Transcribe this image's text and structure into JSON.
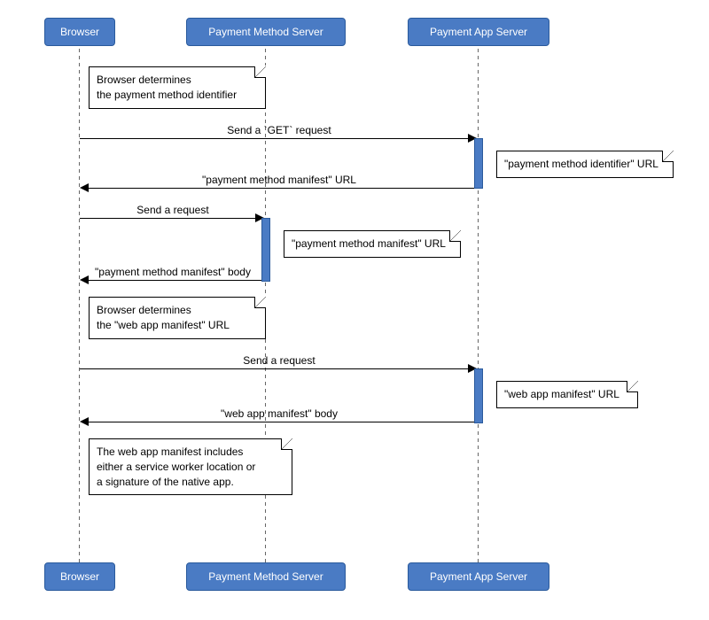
{
  "actors": {
    "browser": "Browser",
    "pms": "Payment Method Server",
    "pas": "Payment App Server"
  },
  "notes": {
    "n1": "Browser determines\nthe payment method identifier",
    "n2": "\"payment method identifier\" URL",
    "n3": "\"payment method manifest\" URL",
    "n4": "Browser determines\nthe \"web app manifest\" URL",
    "n5": "\"web app manifest\" URL",
    "n6": "The web app manifest includes\neither a service worker location or\na signature of the native app."
  },
  "messages": {
    "m1": "Send a `GET` request",
    "m2": "\"payment method manifest\" URL",
    "m3": "Send a request",
    "m4": "\"payment method manifest\" body",
    "m5": "Send a request",
    "m6": "\"web app manifest\" body"
  }
}
